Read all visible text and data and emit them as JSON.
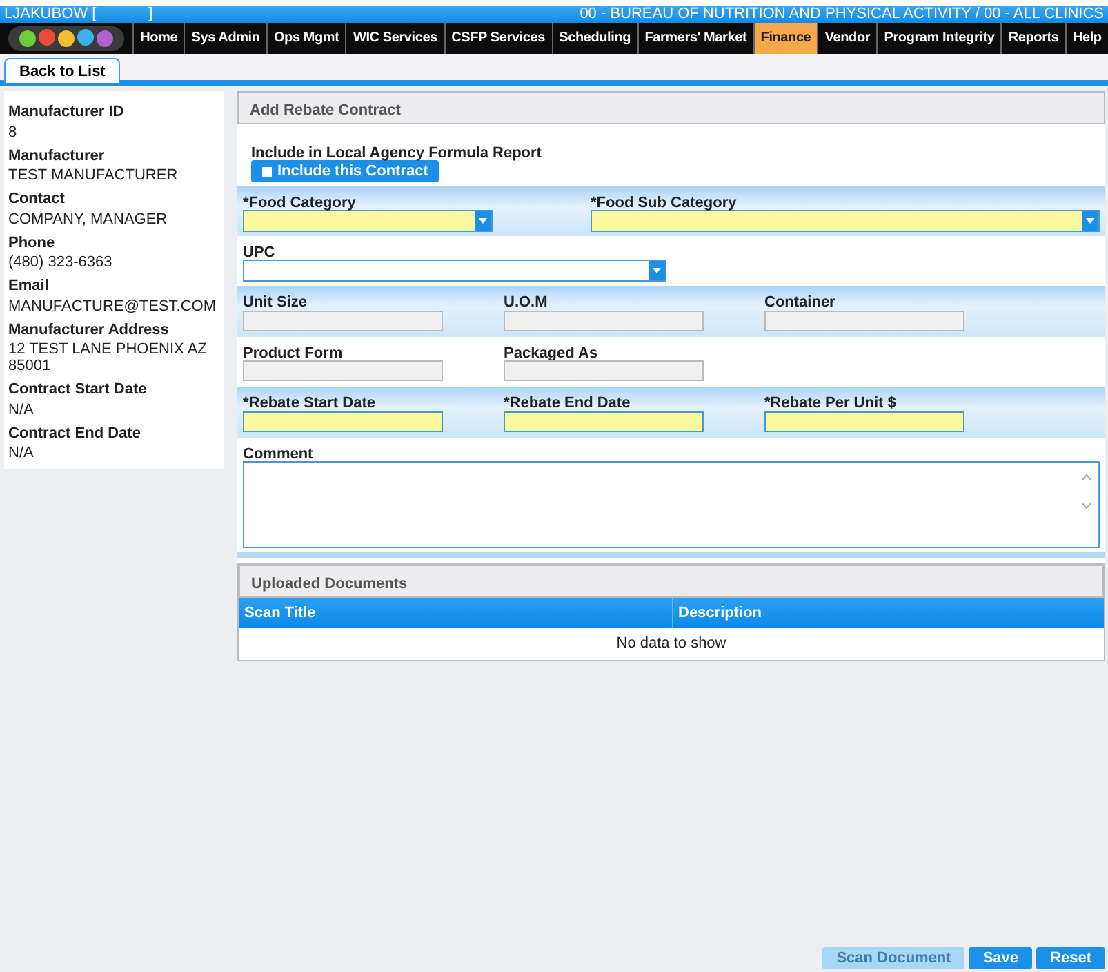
{
  "header": {
    "user": "LJAKUBOW [",
    "user_end": "]",
    "agency": "00 - BUREAU OF NUTRITION AND PHYSICAL ACTIVITY / 00 - ALL CLINICS"
  },
  "nav": [
    {
      "label": "Home",
      "selected": false
    },
    {
      "label": "Sys Admin",
      "selected": false
    },
    {
      "label": "Ops Mgmt",
      "selected": false
    },
    {
      "label": "WIC Services",
      "selected": false
    },
    {
      "label": "CSFP Services",
      "selected": false
    },
    {
      "label": "Scheduling",
      "selected": false
    },
    {
      "label": "Farmers' Market",
      "selected": false
    },
    {
      "label": "Finance",
      "selected": true
    },
    {
      "label": "Vendor",
      "selected": false
    },
    {
      "label": "Program Integrity",
      "selected": false
    },
    {
      "label": "Reports",
      "selected": false
    },
    {
      "label": "Help",
      "selected": false
    }
  ],
  "back_button": "Back to List",
  "sidebar": [
    {
      "label": "Manufacturer ID",
      "value": "8"
    },
    {
      "label": "Manufacturer",
      "value": "TEST MANUFACTURER"
    },
    {
      "label": "Contact",
      "value": "COMPANY, MANAGER"
    },
    {
      "label": "Phone",
      "value": "(480) 323-6363"
    },
    {
      "label": "Email",
      "value": "MANUFACTURE@TEST.COM"
    },
    {
      "label": "Manufacturer Address",
      "value": "12 TEST LANE PHOENIX AZ 85001"
    },
    {
      "label": "Contract Start Date",
      "value": "N/A"
    },
    {
      "label": "Contract End Date",
      "value": "N/A"
    }
  ],
  "form": {
    "title": "Add Rebate Contract",
    "rows": [
      {
        "fields": [
          {
            "kind": "checkbox",
            "label": "Include in Local Agency Formula Report",
            "text": "Include this Contract",
            "checked": false
          }
        ]
      },
      {
        "fields": [
          {
            "kind": "select",
            "label": "*Food Category",
            "required": true
          },
          {
            "kind": "select",
            "label": "*Food Sub Category",
            "required": true
          }
        ]
      },
      {
        "fields": [
          {
            "kind": "select",
            "label": "UPC",
            "required": false
          }
        ]
      },
      {
        "fields": [
          {
            "kind": "text",
            "label": "Unit Size",
            "disabled": true
          },
          {
            "kind": "text",
            "label": "U.O.M",
            "disabled": true
          },
          {
            "kind": "text",
            "label": "Container",
            "disabled": true
          }
        ]
      },
      {
        "fields": [
          {
            "kind": "text",
            "label": "Product Form",
            "disabled": true
          },
          {
            "kind": "text",
            "label": "Packaged As",
            "disabled": true
          }
        ]
      },
      {
        "fields": [
          {
            "kind": "text",
            "label": "*Rebate Start Date",
            "required": true
          },
          {
            "kind": "text",
            "label": "*Rebate End Date",
            "required": true
          },
          {
            "kind": "text",
            "label": "*Rebate Per Unit $",
            "required": true
          }
        ]
      },
      {
        "fields": [
          {
            "kind": "textarea",
            "label": "Comment"
          }
        ]
      }
    ]
  },
  "documents": {
    "title": "Uploaded Documents",
    "columns": [
      "Scan Title",
      "Description"
    ],
    "empty": "No data to show"
  },
  "actions": [
    {
      "label": "Scan Document",
      "disabled": true
    },
    {
      "label": "Save",
      "disabled": false
    },
    {
      "label": "Reset",
      "disabled": false
    }
  ]
}
